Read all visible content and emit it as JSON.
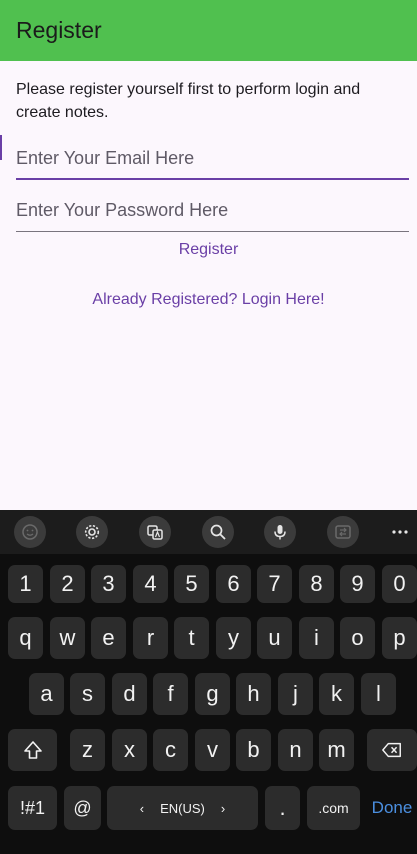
{
  "appbar": {
    "title": "Register"
  },
  "intro": "Please register yourself first to perform login and create notes.",
  "email": {
    "placeholder": "Enter Your Email Here"
  },
  "password": {
    "placeholder": "Enter Your Password Here"
  },
  "register_label": "Register",
  "login_link_label": "Already Registered? Login Here!",
  "keyboard": {
    "numbers": [
      "1",
      "2",
      "3",
      "4",
      "5",
      "6",
      "7",
      "8",
      "9",
      "0"
    ],
    "row1": [
      "q",
      "w",
      "e",
      "r",
      "t",
      "y",
      "u",
      "i",
      "o",
      "p"
    ],
    "row2": [
      "a",
      "s",
      "d",
      "f",
      "g",
      "h",
      "j",
      "k",
      "l"
    ],
    "row3": [
      "z",
      "x",
      "c",
      "v",
      "b",
      "n",
      "m"
    ],
    "symbols": "!#1",
    "at": "@",
    "lang": "EN(US)",
    "period": ".",
    "dotcom": ".com",
    "done": "Done"
  },
  "colors": {
    "appbar": "#50c04f",
    "accent": "#6a3fa6",
    "keyboard_bg": "#0e0e0e",
    "done": "#4b8fe0"
  },
  "toolbar_icons": [
    "emoji-icon",
    "settings-icon",
    "translate-icon",
    "search-icon",
    "microphone-icon",
    "mode-switch-icon",
    "more-icon"
  ]
}
